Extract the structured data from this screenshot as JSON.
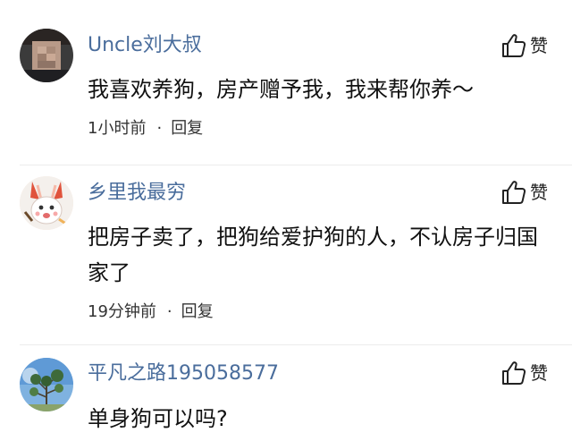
{
  "comments": [
    {
      "username": "Uncle刘大叔",
      "content": "我喜欢养狗，房产赠予我，我来帮你养～",
      "time": "1小时前",
      "reply_label": "回复",
      "like_label": "赞",
      "avatar_icon": "blurred-face-avatar"
    },
    {
      "username": "乡里我最穷",
      "content": "把房子卖了，把狗给爱护狗的人，不认房子归国家了",
      "time": "19分钟前",
      "reply_label": "回复",
      "like_label": "赞",
      "avatar_icon": "cartoon-rabbit-avatar"
    },
    {
      "username": "平凡之路195058577",
      "content": "单身狗可以吗?",
      "like_label": "赞",
      "avatar_icon": "tree-sky-avatar"
    }
  ],
  "separator": "·",
  "colors": {
    "username": "#4a6d9c",
    "text": "#111111",
    "meta": "#333333"
  }
}
